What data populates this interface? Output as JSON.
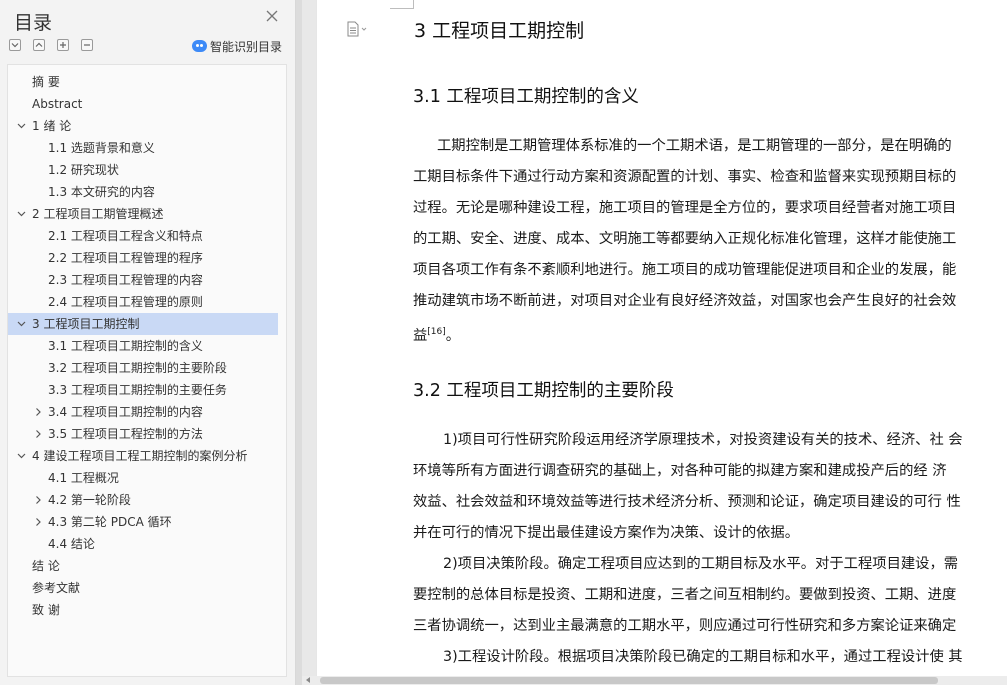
{
  "toc": {
    "title": "目录",
    "smart_label": "智能识别目录",
    "items": [
      {
        "label": "摘  要",
        "level": 0,
        "arrow": "none"
      },
      {
        "label": "Abstract",
        "level": 0,
        "arrow": "none"
      },
      {
        "label": "1 绪  论",
        "level": 0,
        "arrow": "down"
      },
      {
        "label": "1.1 选题背景和意义",
        "level": 1,
        "arrow": "none"
      },
      {
        "label": "1.2 研究现状",
        "level": 1,
        "arrow": "none"
      },
      {
        "label": "1.3 本文研究的内容",
        "level": 1,
        "arrow": "none"
      },
      {
        "label": "2 工程项目工期管理概述",
        "level": 0,
        "arrow": "down"
      },
      {
        "label": "2.1 工程项目工程含义和特点",
        "level": 1,
        "arrow": "none"
      },
      {
        "label": "2.2 工程项目工程管理的程序",
        "level": 1,
        "arrow": "none"
      },
      {
        "label": "2.3 工程项目工程管理的内容",
        "level": 1,
        "arrow": "none"
      },
      {
        "label": "2.4 工程项目工程管理的原则",
        "level": 1,
        "arrow": "none"
      },
      {
        "label": "3 工程项目工期控制",
        "level": 0,
        "arrow": "down",
        "selected": true
      },
      {
        "label": "3.1 工程项目工期控制的含义",
        "level": 1,
        "arrow": "none"
      },
      {
        "label": "3.2 工程项目工期控制的主要阶段",
        "level": 1,
        "arrow": "none"
      },
      {
        "label": "3.3 工程项目工期控制的主要任务",
        "level": 1,
        "arrow": "none"
      },
      {
        "label": "3.4 工程项目工期控制的内容",
        "level": 1,
        "arrow": "right"
      },
      {
        "label": "3.5 工程项目工程控制的方法",
        "level": 1,
        "arrow": "right"
      },
      {
        "label": "4 建设工程项目工程工期控制的案例分析",
        "level": 0,
        "arrow": "down"
      },
      {
        "label": "4.1 工程概况",
        "level": 1,
        "arrow": "none"
      },
      {
        "label": "4.2 第一轮阶段",
        "level": 1,
        "arrow": "right"
      },
      {
        "label": "4.3 第二轮 PDCA 循环",
        "level": 1,
        "arrow": "right"
      },
      {
        "label": "4.4 结论",
        "level": 1,
        "arrow": "none"
      },
      {
        "label": "结  论",
        "level": 0,
        "arrow": "none"
      },
      {
        "label": "参考文献",
        "level": 0,
        "arrow": "none"
      },
      {
        "label": "致  谢",
        "level": 0,
        "arrow": "none"
      }
    ]
  },
  "doc": {
    "h1": "3 工程项目工期控制",
    "h2a": "3.1 工程项目工期控制的含义",
    "p1": [
      "工期控制是工期管理体系标准的一个工期术语，是工期管理的一部分，是在明确的",
      "工期目标条件下通过行动方案和资源配置的计划、事实、检查和监督来实现预期目标的",
      "过程。无论是哪种建设工程，施工项目的管理是全方位的，要求项目经营者对施工项目",
      "的工期、安全、进度、成本、文明施工等都要纳入正规化标准化管理，这样才能使施工",
      "项目各项工作有条不紊顺利地进行。施工项目的成功管理能促进项目和企业的发展，能",
      "推动建筑市场不断前进，对项目对企业有良好经济效益，对国家也会产生良好的社会效",
      "益"
    ],
    "p1_cite": "[16]",
    "p1_end": "。",
    "h2b": "3.2 工程项目工期控制的主要阶段",
    "p2": [
      "1)项目可行性研究阶段运用经济学原理技术，对投资建设有关的技术、经济、社  会",
      "环境等所有方面进行调查研究的基础上，对各种可能的拟建方案和建成投产后的经  济",
      "效益、社会效益和环境效益等进行技术经济分析、预测和论证，确定项目建设的可行  性",
      "并在可行的情况下提出最佳建设方案作为决策、设计的依据。",
      "2)项目决策阶段。确定工程项目应达到的工期目标及水平。对于工程项目建设，需",
      "要控制的总体目标是投资、工期和进度，三者之间互相制约。要做到投资、工期、进度",
      "三者协调统一，达到业主最满意的工期水平，则应通过可行性研究和多方案论证来确定",
      "3)工程设计阶段。根据项目决策阶段已确定的工期目标和水平，通过工程设计使  其"
    ]
  }
}
